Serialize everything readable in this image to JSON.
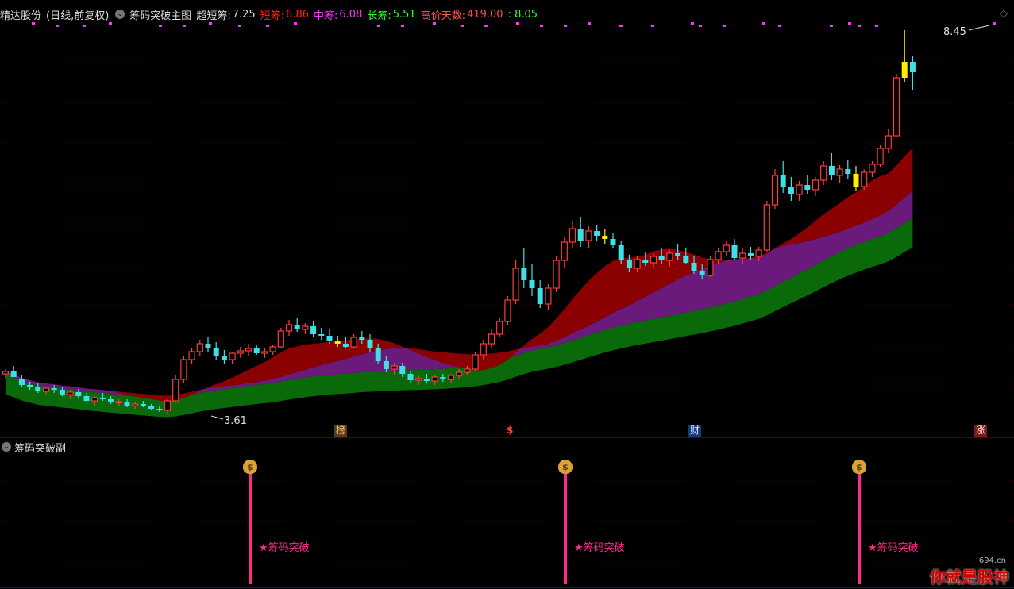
{
  "header": {
    "stock_name": "精达股份",
    "period": "(日线,前复权)",
    "indicator_name": "筹码突破主图",
    "super_short_label": "超短筹:",
    "super_short_value": "7.25",
    "short_label": "短筹:",
    "short_value": "6.86",
    "mid_label": "中筹:",
    "mid_value": "6.08",
    "long_label": "长筹:",
    "long_value": "5.51",
    "high_days_label": "高价天数:",
    "high_days_value": "419.00",
    "high_days_extra": ": 8.05"
  },
  "colors": {
    "up": "#ff3b3b",
    "down": "#3ee0e8",
    "super_short": "#dddddd",
    "short": "#ff2020",
    "mid": "#ff33ff",
    "long": "#33ff33",
    "high_days": "#ff5050",
    "band_red": "#8b0000",
    "band_purple": "#6a1a7a",
    "band_green": "#0a6a0a",
    "signal": "#ff2b8a"
  },
  "price_annotations": {
    "high": "8.45",
    "low": "3.61"
  },
  "event_tags": [
    {
      "label": "榜",
      "color": "#c89a5a"
    },
    {
      "label": "$",
      "color": "#ff4040"
    },
    {
      "label": "财",
      "color": "#3a6fd8"
    },
    {
      "label": "涨",
      "color": "#ff4040"
    }
  ],
  "sub_panel": {
    "title": "筹码突破副",
    "signal_label": "★筹码突破",
    "bag_icon": "$"
  },
  "watermark": {
    "text": "你就是股神",
    "site": "694.cn"
  },
  "chart_data": {
    "type": "candlestick",
    "title": "",
    "price_high": 8.45,
    "price_low": 3.61,
    "ohlc": [
      [
        4.12,
        4.18,
        4.05,
        4.15
      ],
      [
        4.15,
        4.22,
        4.1,
        4.08
      ],
      [
        4.05,
        4.1,
        3.95,
        3.98
      ],
      [
        3.98,
        4.02,
        3.92,
        3.95
      ],
      [
        3.95,
        4.0,
        3.88,
        3.9
      ],
      [
        3.9,
        3.96,
        3.85,
        3.94
      ],
      [
        3.94,
        3.98,
        3.88,
        3.92
      ],
      [
        3.92,
        3.96,
        3.84,
        3.86
      ],
      [
        3.86,
        3.92,
        3.8,
        3.89
      ],
      [
        3.89,
        3.93,
        3.82,
        3.84
      ],
      [
        3.84,
        3.88,
        3.76,
        3.78
      ],
      [
        3.78,
        3.84,
        3.72,
        3.82
      ],
      [
        3.82,
        3.88,
        3.78,
        3.8
      ],
      [
        3.8,
        3.84,
        3.74,
        3.76
      ],
      [
        3.76,
        3.8,
        3.72,
        3.77
      ],
      [
        3.77,
        3.8,
        3.7,
        3.72
      ],
      [
        3.72,
        3.76,
        3.68,
        3.74
      ],
      [
        3.74,
        3.78,
        3.7,
        3.71
      ],
      [
        3.71,
        3.74,
        3.66,
        3.68
      ],
      [
        3.68,
        3.72,
        3.64,
        3.66
      ],
      [
        3.66,
        3.8,
        3.61,
        3.78
      ],
      [
        3.78,
        4.1,
        3.76,
        4.05
      ],
      [
        4.05,
        4.35,
        4.0,
        4.3
      ],
      [
        4.3,
        4.45,
        4.25,
        4.4
      ],
      [
        4.4,
        4.55,
        4.35,
        4.5
      ],
      [
        4.5,
        4.58,
        4.4,
        4.45
      ],
      [
        4.45,
        4.52,
        4.3,
        4.35
      ],
      [
        4.35,
        4.42,
        4.25,
        4.3
      ],
      [
        4.3,
        4.4,
        4.25,
        4.38
      ],
      [
        4.38,
        4.46,
        4.32,
        4.41
      ],
      [
        4.41,
        4.5,
        4.35,
        4.44
      ],
      [
        4.44,
        4.48,
        4.36,
        4.38
      ],
      [
        4.38,
        4.44,
        4.32,
        4.4
      ],
      [
        4.4,
        4.48,
        4.36,
        4.46
      ],
      [
        4.46,
        4.7,
        4.44,
        4.66
      ],
      [
        4.66,
        4.8,
        4.6,
        4.74
      ],
      [
        4.74,
        4.82,
        4.65,
        4.68
      ],
      [
        4.68,
        4.76,
        4.62,
        4.72
      ],
      [
        4.72,
        4.78,
        4.58,
        4.62
      ],
      [
        4.62,
        4.7,
        4.55,
        4.6
      ],
      [
        4.6,
        4.68,
        4.5,
        4.54
      ],
      [
        4.54,
        4.6,
        4.46,
        4.5
      ],
      [
        4.5,
        4.58,
        4.44,
        4.46
      ],
      [
        4.46,
        4.62,
        4.44,
        4.58
      ],
      [
        4.58,
        4.66,
        4.5,
        4.55
      ],
      [
        4.55,
        4.62,
        4.4,
        4.44
      ],
      [
        4.44,
        4.5,
        4.24,
        4.28
      ],
      [
        4.28,
        4.34,
        4.14,
        4.18
      ],
      [
        4.18,
        4.26,
        4.1,
        4.22
      ],
      [
        4.22,
        4.26,
        4.08,
        4.12
      ],
      [
        4.12,
        4.16,
        4.0,
        4.04
      ],
      [
        4.04,
        4.1,
        3.98,
        4.06
      ],
      [
        4.06,
        4.12,
        4.0,
        4.03
      ],
      [
        4.03,
        4.1,
        3.98,
        4.08
      ],
      [
        4.08,
        4.12,
        4.02,
        4.05
      ],
      [
        4.05,
        4.12,
        4.0,
        4.1
      ],
      [
        4.1,
        4.18,
        4.06,
        4.14
      ],
      [
        4.14,
        4.22,
        4.1,
        4.18
      ],
      [
        4.18,
        4.4,
        4.16,
        4.36
      ],
      [
        4.36,
        4.55,
        4.3,
        4.5
      ],
      [
        4.5,
        4.68,
        4.45,
        4.62
      ],
      [
        4.62,
        4.82,
        4.58,
        4.78
      ],
      [
        4.78,
        5.1,
        4.74,
        5.05
      ],
      [
        5.05,
        5.55,
        5.0,
        5.45
      ],
      [
        5.45,
        5.7,
        5.2,
        5.3
      ],
      [
        5.3,
        5.5,
        5.1,
        5.2
      ],
      [
        5.2,
        5.3,
        4.95,
        5.0
      ],
      [
        5.0,
        5.25,
        4.92,
        5.2
      ],
      [
        5.2,
        5.6,
        5.15,
        5.55
      ],
      [
        5.55,
        5.85,
        5.45,
        5.78
      ],
      [
        5.78,
        6.05,
        5.7,
        5.95
      ],
      [
        5.95,
        6.1,
        5.72,
        5.8
      ],
      [
        5.8,
        5.98,
        5.7,
        5.92
      ],
      [
        5.92,
        6.0,
        5.8,
        5.86
      ],
      [
        5.86,
        5.95,
        5.75,
        5.82
      ],
      [
        5.82,
        5.9,
        5.7,
        5.74
      ],
      [
        5.74,
        5.8,
        5.5,
        5.55
      ],
      [
        5.55,
        5.62,
        5.4,
        5.45
      ],
      [
        5.45,
        5.6,
        5.4,
        5.56
      ],
      [
        5.56,
        5.66,
        5.48,
        5.52
      ],
      [
        5.52,
        5.64,
        5.46,
        5.6
      ],
      [
        5.6,
        5.7,
        5.5,
        5.55
      ],
      [
        5.55,
        5.68,
        5.48,
        5.64
      ],
      [
        5.64,
        5.75,
        5.55,
        5.6
      ],
      [
        5.6,
        5.7,
        5.5,
        5.52
      ],
      [
        5.52,
        5.6,
        5.38,
        5.42
      ],
      [
        5.42,
        5.5,
        5.32,
        5.36
      ],
      [
        5.36,
        5.6,
        5.34,
        5.56
      ],
      [
        5.56,
        5.7,
        5.5,
        5.66
      ],
      [
        5.66,
        5.8,
        5.6,
        5.74
      ],
      [
        5.74,
        5.82,
        5.55,
        5.58
      ],
      [
        5.58,
        5.7,
        5.5,
        5.64
      ],
      [
        5.64,
        5.72,
        5.56,
        5.6
      ],
      [
        5.6,
        5.72,
        5.54,
        5.68
      ],
      [
        5.68,
        6.3,
        5.66,
        6.25
      ],
      [
        6.25,
        6.7,
        6.2,
        6.62
      ],
      [
        6.62,
        6.8,
        6.4,
        6.48
      ],
      [
        6.48,
        6.6,
        6.3,
        6.38
      ],
      [
        6.38,
        6.55,
        6.3,
        6.5
      ],
      [
        6.5,
        6.62,
        6.38,
        6.44
      ],
      [
        6.44,
        6.6,
        6.36,
        6.56
      ],
      [
        6.56,
        6.8,
        6.5,
        6.74
      ],
      [
        6.74,
        6.9,
        6.56,
        6.62
      ],
      [
        6.62,
        6.75,
        6.52,
        6.7
      ],
      [
        6.7,
        6.82,
        6.58,
        6.64
      ],
      [
        6.64,
        6.74,
        6.42,
        6.48
      ],
      [
        6.48,
        6.7,
        6.44,
        6.66
      ],
      [
        6.66,
        6.8,
        6.6,
        6.76
      ],
      [
        6.76,
        7.0,
        6.72,
        6.96
      ],
      [
        6.96,
        7.2,
        6.9,
        7.12
      ],
      [
        7.12,
        7.9,
        7.1,
        7.85
      ],
      [
        7.85,
        8.45,
        7.8,
        8.05
      ],
      [
        8.05,
        8.12,
        7.7,
        7.92
      ]
    ]
  }
}
